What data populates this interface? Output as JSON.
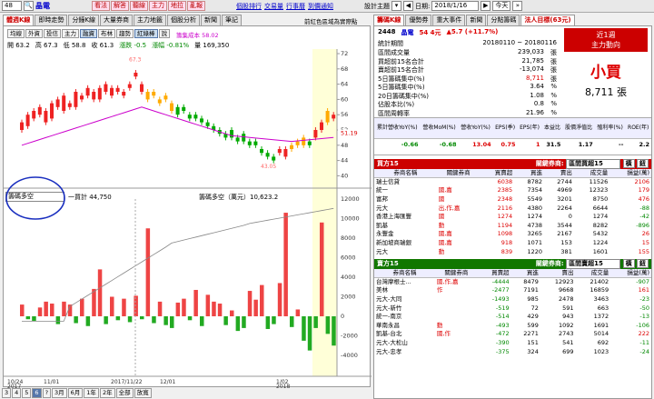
{
  "topbar": {
    "code": "48",
    "name": "晶電",
    "tools": [
      "看法",
      "解答",
      "聽線",
      "主力",
      "地拉",
      "亂報"
    ],
    "links": [
      "個股排行",
      "交易量",
      "行事曆",
      "到價通知"
    ],
    "settings_label": "設計主題",
    "date": "2018/1/16",
    "today": "今天"
  },
  "left_tabs": [
    "體週K線",
    "即時走勢",
    "分鐘K線",
    "大量券商",
    "主力地籤",
    "個股分析",
    "新聞",
    "筆記"
  ],
  "left_note": "前紅色區域為實際點",
  "right_tabs": [
    "籌碼K線",
    "優勢券",
    "重大事件",
    "新聞",
    "分點籌碼",
    "法人目標(63元)"
  ],
  "chart_toolbar": [
    "均線",
    "外資",
    "投信",
    "主力",
    "融資",
    "布林",
    "趨勢",
    "紅綠棒",
    "說"
  ],
  "kline": {
    "legend": "籌集成本 58.02",
    "open": "開 63.2",
    "high": "高 67.3",
    "low": "低 58.8",
    "close": "收 61.3",
    "change": "漲跌 -0.5",
    "pct": "漲幅 -0.81%",
    "vol": "量 169,350",
    "peak": "67.3",
    "trough": "43.05",
    "last": "51.19",
    "yticks": [
      "72",
      "68",
      "64",
      "60",
      "56",
      "52",
      "48",
      "44",
      "40"
    ]
  },
  "sub": {
    "select": "籌碼多空",
    "legend1": "一買計 44,750",
    "legend2": "籌碼多空（萬元）10,623.2",
    "yticks": [
      "12000",
      "10000",
      "8000",
      "6000",
      "4000",
      "2000",
      "0",
      "-2000",
      "-4000"
    ],
    "xticks": [
      "10/24 2017",
      "11/01",
      "2017/11/22",
      "12/01",
      "1/02 2018"
    ]
  },
  "summary": {
    "code": "2448",
    "name": "晶電",
    "price": "54 4元",
    "chg": "▲5.7 (+11.7%)",
    "period_label": "統計期間",
    "period": "20180110 ~ 20180116",
    "rows": [
      [
        "區間成交量",
        "239,033",
        "張"
      ],
      [
        "買超前15名合計",
        "21,785",
        "張"
      ],
      [
        "賣超前15名合計",
        "-13,074",
        "張"
      ],
      [
        "5日籌碼集中(%)",
        "8,711",
        "張"
      ],
      [
        "5日籌碼集中(%)",
        "3.64",
        "%"
      ],
      [
        "20日籌碼集中(%)",
        "1.08",
        "%"
      ],
      [
        "佔股本比(%)",
        "0.8",
        "%"
      ],
      [
        "區間周轉率",
        "21.96",
        "%"
      ]
    ],
    "box_title": "近1週",
    "box_sub": "主力動向",
    "verdict": "小買",
    "amount": "8,711",
    "unit": "張"
  },
  "fund": {
    "headers": [
      "累計營收YoY(%)",
      "營收MoM(%)",
      "營收YoY(%)",
      "EPS(季)",
      "EPS(年)",
      "本益比",
      "股價淨值比",
      "殖利率(%)",
      "ROE(年)"
    ],
    "values": [
      "-0.66",
      "-0.68",
      "13.04",
      "0.75",
      "1",
      "31.5",
      "1.17",
      "--",
      "2.2"
    ]
  },
  "buy": {
    "title": "買方15",
    "filter_label": "關鍵券商:",
    "filter": "區間買超15",
    "btn1": "橫",
    "btn2": "鈕",
    "headers": [
      "券商名稱",
      "關鍵券商",
      "買賣超",
      "買進",
      "賣出",
      "成交量",
      "損益(萬)"
    ],
    "rows": [
      [
        "瑞士信貸",
        "",
        "6038",
        "8782",
        "2744",
        "11526",
        "2106"
      ],
      [
        "統一",
        "國,嘉",
        "2385",
        "7354",
        "4969",
        "12323",
        "179"
      ],
      [
        "富邦",
        "國",
        "2348",
        "5549",
        "3201",
        "8750",
        "476"
      ],
      [
        "元大",
        "出,作,嘉",
        "2116",
        "4380",
        "2264",
        "6644",
        "-88"
      ],
      [
        "香港上海匯豐",
        "國",
        "1274",
        "1274",
        "0",
        "1274",
        "-42"
      ],
      [
        "凱基",
        "動",
        "1194",
        "4738",
        "3544",
        "8282",
        "-896"
      ],
      [
        "永豐金",
        "國,嘉",
        "1098",
        "3265",
        "2167",
        "5432",
        "26"
      ],
      [
        "新加坡商瑞銀",
        "國,嘉",
        "918",
        "1071",
        "153",
        "1224",
        "15"
      ],
      [
        "元大",
        "動",
        "839",
        "1220",
        "381",
        "1601",
        "155"
      ]
    ]
  },
  "sell": {
    "title": "賣方15",
    "filter_label": "關鍵券商:",
    "filter": "區間賣超15",
    "btn1": "橫",
    "btn2": "鈕",
    "headers": [
      "券商名稱",
      "關鍵券商",
      "買賣超",
      "買進",
      "賣出",
      "成交量",
      "損益(萬)"
    ],
    "rows": [
      [
        "台灣摩根士...",
        "國,作,嘉",
        "-4444",
        "8479",
        "12923",
        "21402",
        "-907"
      ],
      [
        "美林",
        "作",
        "-2477",
        "7191",
        "9668",
        "16859",
        "161"
      ],
      [
        "元大-大同",
        "",
        "-1493",
        "985",
        "2478",
        "3463",
        "-23"
      ],
      [
        "元大-新竹",
        "",
        "-519",
        "72",
        "591",
        "663",
        "-50"
      ],
      [
        "統一-南京",
        "",
        "-514",
        "429",
        "943",
        "1372",
        "-13"
      ],
      [
        "華南永昌",
        "動",
        "-493",
        "599",
        "1092",
        "1691",
        "-106"
      ],
      [
        "凱基-台北",
        "國,作",
        "-472",
        "2271",
        "2743",
        "5014",
        "222"
      ],
      [
        "元大-大松山",
        "",
        "-390",
        "151",
        "541",
        "692",
        "-11"
      ],
      [
        "元大-忠孝",
        "",
        "-375",
        "324",
        "699",
        "1023",
        "-24"
      ]
    ]
  },
  "bottom": [
    "3",
    "4",
    "5",
    "6",
    "?",
    "3月",
    "6月",
    "1年",
    "2年",
    "全部",
    "放寬"
  ]
}
